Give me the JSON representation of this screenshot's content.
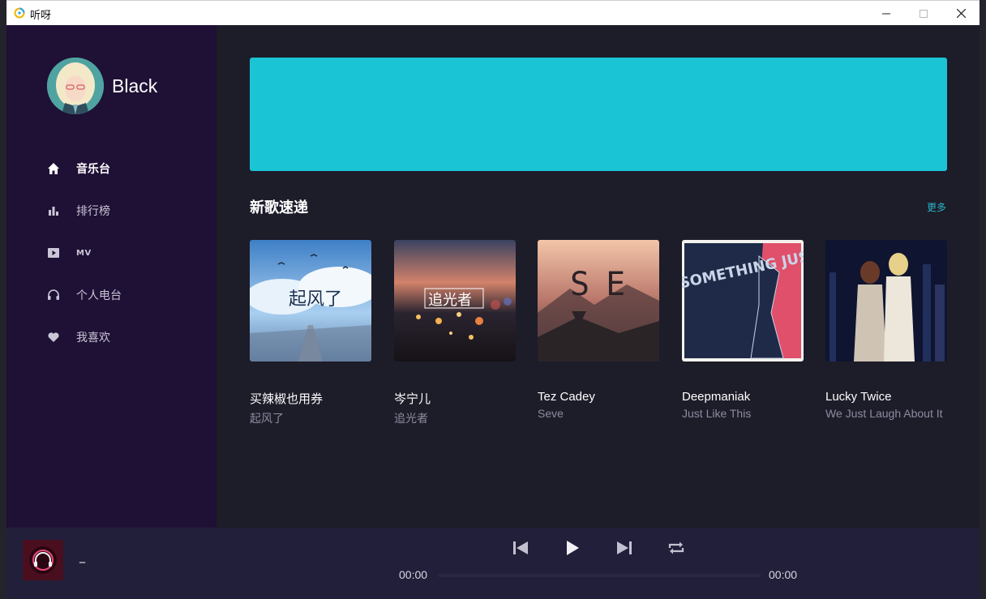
{
  "window": {
    "title": "听呀"
  },
  "user": {
    "name": "Black"
  },
  "nav": {
    "items": [
      {
        "label": "音乐台",
        "icon": "home-icon",
        "active": true
      },
      {
        "label": "排行榜",
        "icon": "bar-chart-icon",
        "active": false
      },
      {
        "label": "MV",
        "icon": "video-play-icon",
        "active": false
      },
      {
        "label": "个人电台",
        "icon": "headphones-icon",
        "active": false
      },
      {
        "label": "我喜欢",
        "icon": "heart-icon",
        "active": false
      }
    ]
  },
  "section": {
    "title": "新歌速递",
    "more": "更多"
  },
  "albums": [
    {
      "name": "买辣椒也用券",
      "artist": "起风了",
      "cover_text": "起风了"
    },
    {
      "name": "岑宁儿",
      "artist": "追光者",
      "cover_text": "追光者"
    },
    {
      "name": "Tez Cadey",
      "artist": "Seve",
      "cover_text": "SE"
    },
    {
      "name": "Deepmaniak",
      "artist": "Just Like This",
      "cover_text": "SOMETHING JUST LIKE THIS"
    },
    {
      "name": "Lucky Twice",
      "artist": "We Just Laugh About It",
      "cover_text": ""
    }
  ],
  "player": {
    "title": "_",
    "current_time": "00:00",
    "total_time": "00:00",
    "progress": 0
  },
  "colors": {
    "banner": "#1bc4d4",
    "sidebar": "#1f1035",
    "accent": "#26b6c8"
  }
}
